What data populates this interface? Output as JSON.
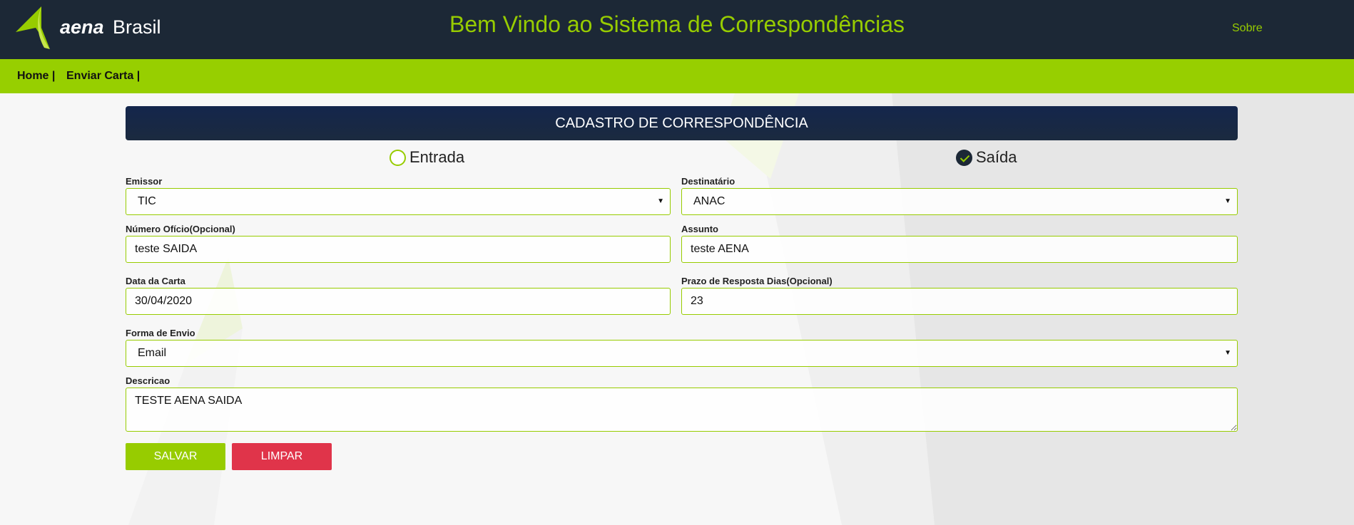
{
  "header": {
    "brand_word1": "aena",
    "brand_word2": "Brasil",
    "title": "Bem Vindo ao Sistema de Correspondências",
    "about_label": "Sobre"
  },
  "nav": {
    "items": [
      {
        "label": "Home |"
      },
      {
        "label": "Enviar Carta |"
      }
    ]
  },
  "form": {
    "header": "CADASTRO DE CORRESPONDÊNCIA",
    "direction": {
      "options": [
        {
          "label": "Entrada",
          "checked": false
        },
        {
          "label": "Saída",
          "checked": true
        }
      ]
    },
    "emissor": {
      "label": "Emissor",
      "value": "TIC"
    },
    "destinatario": {
      "label": "Destinatário",
      "value": "ANAC"
    },
    "numero_oficio": {
      "label": "Número Ofício(Opcional)",
      "value": "teste SAIDA"
    },
    "assunto": {
      "label": "Assunto",
      "value": "teste AENA"
    },
    "data_carta": {
      "label": "Data da Carta",
      "value": "30/04/2020"
    },
    "prazo": {
      "label": "Prazo de Resposta Dias(Opcional)",
      "value": "23"
    },
    "forma_envio": {
      "label": "Forma de Envio",
      "value": "Email"
    },
    "descricao": {
      "label": "Descricao",
      "value": "TESTE AENA SAIDA"
    },
    "save_label": "SALVAR",
    "clear_label": "LIMPAR"
  },
  "colors": {
    "accent_green": "#97cc00",
    "dark_navy": "#1c2836",
    "danger_red": "#e0344a"
  },
  "icons": {
    "caret": "caret-down-icon",
    "check": "check-icon"
  }
}
